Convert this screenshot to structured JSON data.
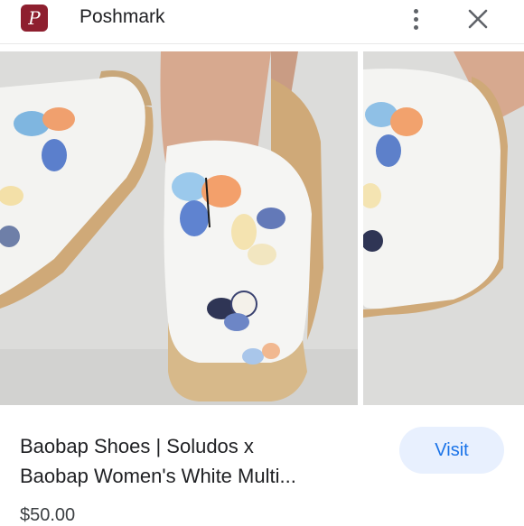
{
  "header": {
    "favicon_icon": "poshmark-logo-icon",
    "favicon_glyph": "P",
    "site_name": "Poshmark",
    "more_icon": "more-vertical-icon",
    "close_icon": "close-icon"
  },
  "images": {
    "main_alt": "White embroidered butterfly espadrille mule",
    "side_alt": "White embroidered butterfly espadrille mule, second view"
  },
  "result": {
    "title_line1": "Baobap Shoes | Soludos x",
    "title_line2": "Baobap Women's White Multi...",
    "price": "$50.00",
    "visit_label": "Visit"
  },
  "colors": {
    "brand": "#8e1f2f",
    "visit_bg": "#e8f0fe",
    "visit_text": "#1a73e8"
  }
}
